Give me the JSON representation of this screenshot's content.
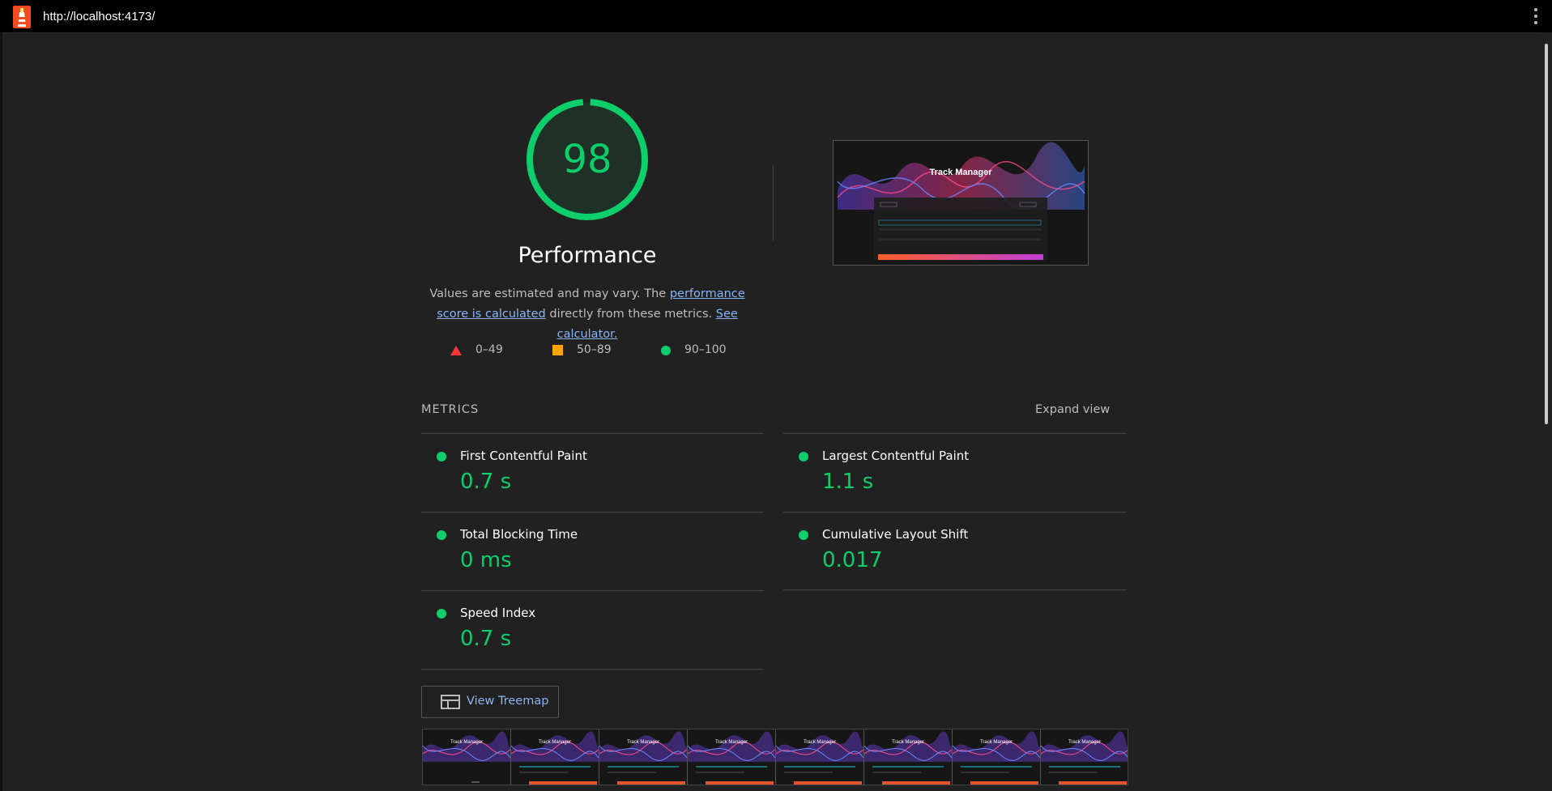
{
  "topbar": {
    "url": "http://localhost:4173/"
  },
  "gauge": {
    "score": "98",
    "score_value": 98,
    "title": "Performance",
    "color": "#0cce6b"
  },
  "description": {
    "part1": "Values are estimated and may vary. The ",
    "link1": "performance score is calculated",
    "part2": " directly from these metrics. ",
    "link2": "See calculator."
  },
  "legend": {
    "fail": "0–49",
    "average": "50–89",
    "pass": "90–100"
  },
  "preview": {
    "heading": "Track Manager"
  },
  "metrics": {
    "header": "METRICS",
    "expand_label": "Expand view",
    "items": [
      {
        "title": "First Contentful Paint",
        "value": "0.7 s"
      },
      {
        "title": "Largest Contentful Paint",
        "value": "1.1 s"
      },
      {
        "title": "Total Blocking Time",
        "value": "0 ms"
      },
      {
        "title": "Cumulative Layout Shift",
        "value": "0.017"
      },
      {
        "title": "Speed Index",
        "value": "0.7 s"
      }
    ]
  },
  "treemap": {
    "label": "View Treemap"
  },
  "filmstrip": {
    "frame_heading": "Track Manager"
  },
  "colors": {
    "pass": "#0cce6b",
    "average": "#ffa400",
    "fail": "#ff3333",
    "link": "#8ab4f8"
  }
}
